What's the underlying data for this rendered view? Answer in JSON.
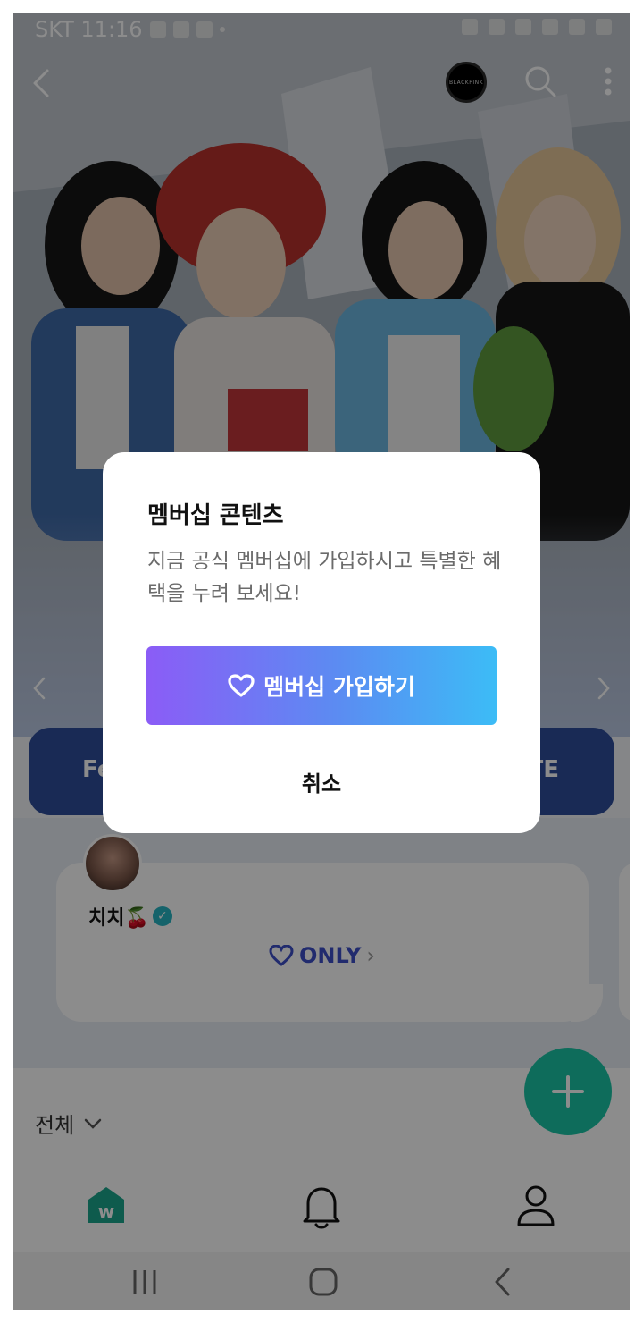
{
  "status_bar": {
    "carrier_time": "SKT 11:16"
  },
  "artist_logo": {
    "text": "BLACKPINK"
  },
  "tabs": {
    "left": "Fe",
    "right": "TE"
  },
  "post": {
    "author": "치치🍒",
    "badge": "ONLY"
  },
  "list": {
    "filter": "전체"
  },
  "modal": {
    "title": "멤버십 콘텐츠",
    "description": "지금 공식 멤버십에 가입하시고 특별한 혜택을 누려 보세요!",
    "join_label": "멤버십 가입하기",
    "cancel_label": "취소"
  },
  "colors": {
    "accent_start": "#8b5cf6",
    "accent_end": "#3cbcf6",
    "fab": "#1bc5a6"
  }
}
